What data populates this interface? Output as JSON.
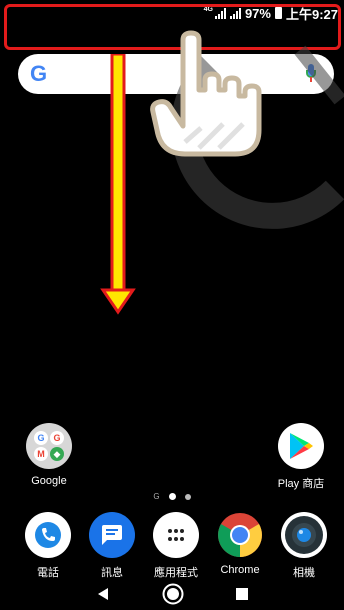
{
  "status_bar": {
    "network_tag": "4G",
    "battery": "97%",
    "time": "上午9:27"
  },
  "search_bar": {
    "logo": "G"
  },
  "home": {
    "google_folder_label": "Google",
    "play_store_label": "Play 商店",
    "page_indicator_g": "G"
  },
  "dock": {
    "phone_label": "電話",
    "messages_label": "訊息",
    "apps_label": "應用程式",
    "chrome_label": "Chrome",
    "camera_label": "相機"
  },
  "annotation": {
    "arrow_color": "#ffe600",
    "arrow_outline": "#e31b1b",
    "highlight_color": "#e31b1b"
  },
  "icons": [
    "signal-icon",
    "battery-icon",
    "mic-icon",
    "back-icon",
    "home-icon",
    "recents-icon"
  ]
}
